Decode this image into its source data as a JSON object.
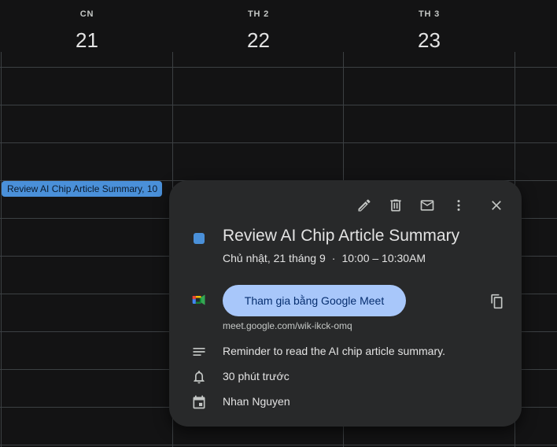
{
  "days": [
    {
      "dow": "CN",
      "num": "21"
    },
    {
      "dow": "TH 2",
      "num": "22"
    },
    {
      "dow": "TH 3",
      "num": "23"
    }
  ],
  "event_chip": {
    "label": "Review AI Chip Article Summary, 10"
  },
  "popup": {
    "toolbar": {
      "edit_icon": "pencil-icon",
      "delete_icon": "trash-icon",
      "email_icon": "mail-icon",
      "more_icon": "more-vert-icon",
      "close_icon": "close-icon"
    },
    "event_color": "#4a90d9",
    "title": "Review AI Chip Article Summary",
    "date": "Chủ nhật, 21 tháng 9",
    "separator": "·",
    "time": "10:00 – 10:30AM",
    "meet_button": "Tham gia bằng Google Meet",
    "meet_link": "meet.google.com/wik-ikck-omq",
    "description": "Reminder to read the AI chip article summary.",
    "reminder": "30 phút trước",
    "calendar_owner": "Nhan Nguyen"
  }
}
